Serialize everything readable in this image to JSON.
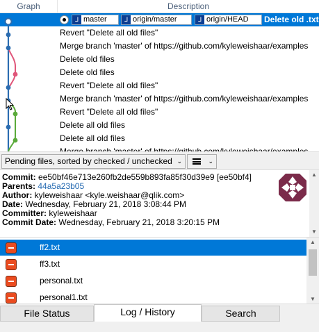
{
  "grid": {
    "header_graph": "Graph",
    "header_description": "Description",
    "selected_refs": [
      "master",
      "origin/master",
      "origin/HEAD"
    ],
    "selected_message": "Delete old .txt",
    "rows": [
      "Revert \"Delete all old files\"",
      "Merge branch 'master' of https://github.com/kyleweishaar/examples",
      "Delete old files",
      "Delete old files",
      "Revert \"Delete all old files\"",
      "Merge branch 'master' of https://github.com/kyleweishaar/examples",
      "Revert \"Delete all old files\"",
      "Delete all old files",
      "Delete all old files",
      "Merge branch 'master' of https://github.com/kyleweishaar/examples"
    ],
    "ref_tag_glyph": "ᒧ"
  },
  "toolbar": {
    "filter_combo": "Pending files, sorted by checked / unchecked",
    "combo_arrow": "⌄"
  },
  "commit": {
    "commit_label": "Commit:",
    "commit_value": "ee50bf46e713e260fb2de559b893fa85f30d39e9 [ee50bf4]",
    "parents_label": "Parents:",
    "parents_value": "44a5a23b05",
    "author_label": "Author:",
    "author_value": "kyleweishaar <kyle.weishaar@qlik.com>",
    "date_label": "Date:",
    "date_value": "Wednesday, February 21, 2018 3:08:44 PM",
    "committer_label": "Committer:",
    "committer_value": "kyleweishaar",
    "commit_date_label": "Commit Date:",
    "commit_date_value": "Wednesday, February 21, 2018 3:20:15 PM"
  },
  "files": [
    "ff2.txt",
    "ff3.txt",
    "personal.txt",
    "personal1.txt"
  ],
  "tabs": [
    "File Status",
    "Log / History",
    "Search"
  ],
  "colors": {
    "selection": "#0078d7",
    "branch_blue": "#2b6cb0",
    "branch_pink": "#e0567a",
    "branch_green": "#5aaa3a",
    "file_removed": "#ea4b1f"
  }
}
